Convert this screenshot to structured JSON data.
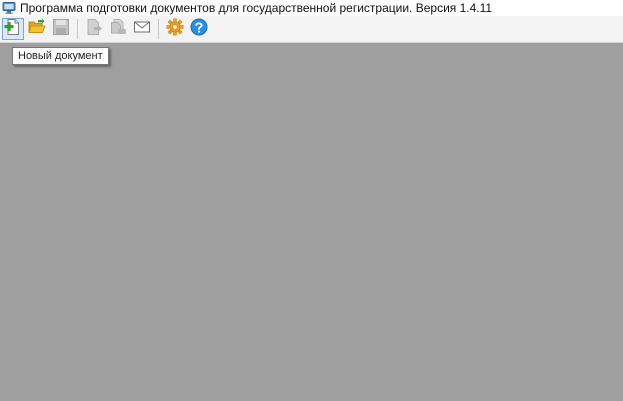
{
  "window": {
    "title": "Программа подготовки документов для государственной регистрации. Версия 1.4.11"
  },
  "toolbar": {
    "buttons": [
      {
        "icon": "new-document-icon",
        "enabled": true,
        "active": true
      },
      {
        "icon": "open-folder-icon",
        "enabled": true
      },
      {
        "icon": "save-icon",
        "enabled": false
      },
      {
        "icon": "document-arrow-icon",
        "enabled": false
      },
      {
        "icon": "documents-stack-icon",
        "enabled": false
      },
      {
        "icon": "envelope-icon",
        "enabled": true
      },
      {
        "icon": "settings-gear-icon",
        "enabled": true
      },
      {
        "icon": "help-icon",
        "enabled": true
      }
    ]
  },
  "tooltip": {
    "text": "Новый документ"
  },
  "colors": {
    "workspace": "#9f9f9f",
    "toolbar_bg": "#f3f3f3",
    "accent_green": "#3a9a2e",
    "folder_yellow": "#f2c230",
    "gear_orange": "#f0a020",
    "help_blue": "#2a8fe0"
  }
}
